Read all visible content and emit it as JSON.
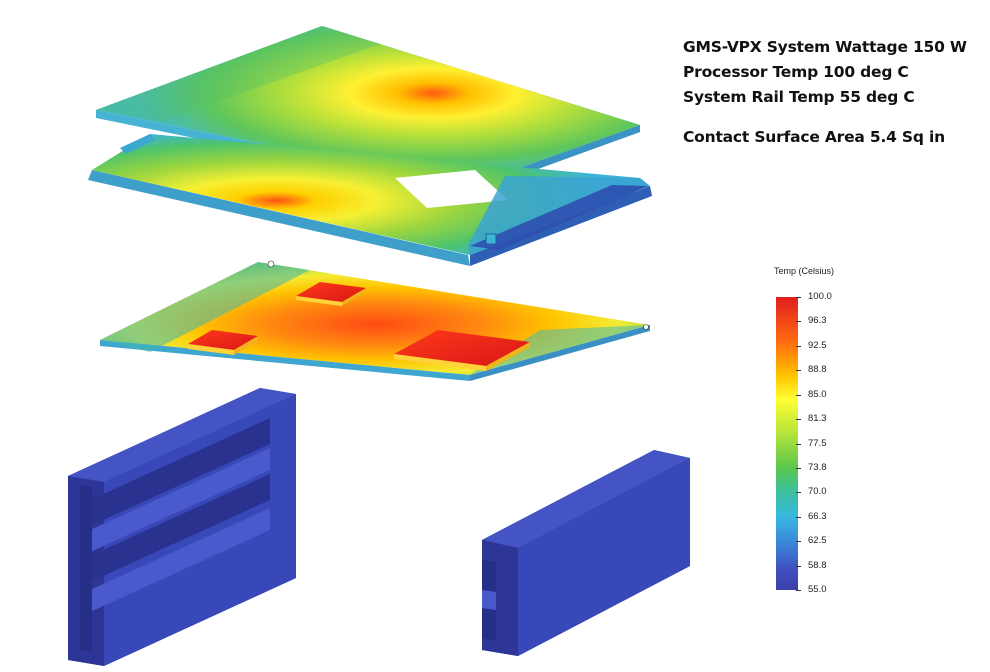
{
  "info": {
    "line1": "GMS-VPX System Wattage 150 W",
    "line2": "Processor Temp 100 deg C",
    "line3": "System Rail Temp 55 deg C",
    "line4": "Contact Surface Area 5.4 Sq in"
  },
  "legend": {
    "title": "Temp (Celsius)",
    "ticks": [
      "100.0",
      "96.3",
      "92.5",
      "88.8",
      "85.0",
      "81.3",
      "77.5",
      "73.8",
      "70.0",
      "66.3",
      "62.5",
      "58.8",
      "55.0"
    ],
    "min": 55.0,
    "max": 100.0,
    "colors": {
      "hot": "#e01e1e",
      "warm": "#ffc400",
      "mid": "#5cc84a",
      "cool": "#38b8e0",
      "cold": "#3d3fa8"
    }
  },
  "components": [
    "top-cover-plate",
    "middle-frame",
    "circuit-board",
    "processor-chip-1",
    "processor-chip-2",
    "processor-chip-3",
    "left-rail-block",
    "right-rail-block"
  ]
}
